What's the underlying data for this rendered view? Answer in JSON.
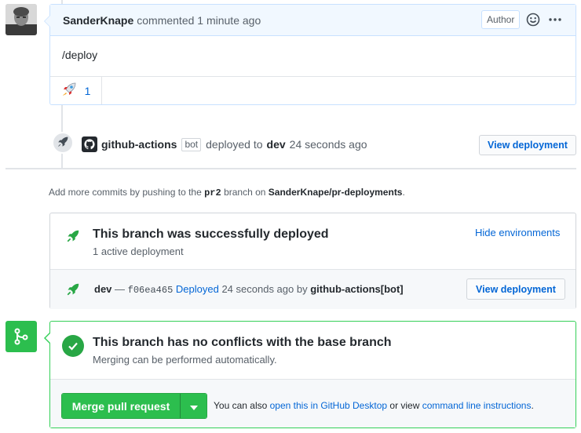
{
  "comment": {
    "author": "SanderKnape",
    "meta": "commented 1 minute ago",
    "author_label": "Author",
    "body": "/deploy",
    "reaction_count": "1"
  },
  "deploy_event": {
    "actor": "github-actions",
    "bot_label": "bot",
    "action": "deployed to",
    "environment": "dev",
    "time": "24 seconds ago",
    "button": "View deployment"
  },
  "add_more": {
    "prefix": "Add more commits by pushing to the",
    "branch": "pr2",
    "middle": "branch on",
    "repo": "SanderKnape/pr-deployments",
    "suffix": "."
  },
  "deployments": {
    "title": "This branch was successfully deployed",
    "subtitle": "1 active deployment",
    "hide_link": "Hide environments",
    "env": "dev",
    "dash": "—",
    "sha": "f06ea465",
    "status_link": "Deployed",
    "time": "24 seconds ago by",
    "by": "github-actions[bot]",
    "button": "View deployment"
  },
  "merge": {
    "title": "This branch has no conflicts with the base branch",
    "subtitle": "Merging can be performed automatically.",
    "button": "Merge pull request",
    "help_prefix": "You can also",
    "desktop_link": "open this in GitHub Desktop",
    "help_mid": "or view",
    "cli_link": "command line instructions",
    "help_suffix": "."
  },
  "colors": {
    "link": "#0366d6",
    "success": "#2cbe4e",
    "comment_header": "#f1f8ff"
  }
}
